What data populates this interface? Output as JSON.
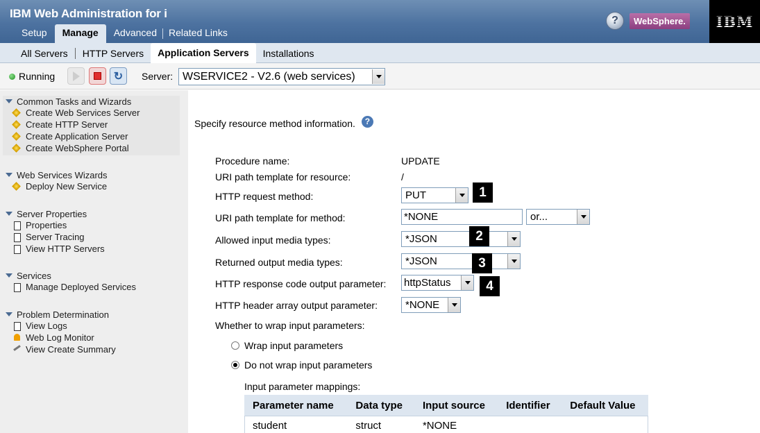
{
  "header": {
    "app_title": "IBM Web Administration for i",
    "tabs": [
      {
        "label": "Setup"
      },
      {
        "label": "Manage"
      },
      {
        "label": "Advanced"
      },
      {
        "label": "Related Links"
      }
    ],
    "help_glyph": "?",
    "websphere_label": "WebSphere.",
    "ibm_logo": "IBM"
  },
  "subnav": {
    "items": [
      {
        "label": "All Servers"
      },
      {
        "label": "HTTP Servers"
      },
      {
        "label": "Application Servers"
      },
      {
        "label": "Installations"
      }
    ]
  },
  "toolbar": {
    "status": "Running",
    "server_label": "Server:",
    "server_value": "WSERVICE2 - V2.6 (web services)",
    "refresh_glyph": "↻"
  },
  "sidebar": {
    "groups": [
      {
        "title": "Common Tasks and Wizards",
        "items": [
          {
            "label": "Create Web Services Server",
            "icon": "wizard-icon"
          },
          {
            "label": "Create HTTP Server",
            "icon": "wizard-icon"
          },
          {
            "label": "Create Application Server",
            "icon": "wizard-icon"
          },
          {
            "label": "Create WebSphere Portal",
            "icon": "wizard-icon"
          }
        ]
      },
      {
        "title": "Web Services Wizards",
        "items": [
          {
            "label": "Deploy New Service",
            "icon": "wizard-icon"
          }
        ]
      },
      {
        "title": "Server Properties",
        "items": [
          {
            "label": "Properties",
            "icon": "document-icon"
          },
          {
            "label": "Server Tracing",
            "icon": "document-icon"
          },
          {
            "label": "View HTTP Servers",
            "icon": "document-icon"
          }
        ]
      },
      {
        "title": "Services",
        "items": [
          {
            "label": "Manage Deployed Services",
            "icon": "document-icon"
          }
        ]
      },
      {
        "title": "Problem Determination",
        "items": [
          {
            "label": "View Logs",
            "icon": "document-icon"
          },
          {
            "label": "Web Log Monitor",
            "icon": "bell-icon"
          },
          {
            "label": "View Create Summary",
            "icon": "key-icon"
          }
        ]
      }
    ]
  },
  "main": {
    "instruction": "Specify resource method information.",
    "help_glyph": "?",
    "fields": {
      "procedure_name_label": "Procedure name:",
      "procedure_name_value": "UPDATE",
      "uri_resource_label": "URI path template for resource:",
      "uri_resource_value": "/",
      "http_method_label": "HTTP request method:",
      "http_method_value": "PUT",
      "uri_method_label": "URI path template for method:",
      "uri_method_value": "*NONE",
      "uri_method_or_value": "or...",
      "input_media_label": "Allowed input media types:",
      "input_media_value": "*JSON",
      "output_media_label": "Returned output media types:",
      "output_media_value": "*JSON",
      "response_code_label": "HTTP response code output parameter:",
      "response_code_value": "httpStatus",
      "header_array_label": "HTTP header array output parameter:",
      "header_array_value": "*NONE",
      "wrap_question": "Whether to wrap input parameters:",
      "wrap_option": "Wrap input parameters",
      "no_wrap_option": "Do not wrap input parameters",
      "selected_wrap": "Do not wrap input parameters"
    },
    "callouts": [
      "1",
      "2",
      "3",
      "4"
    ],
    "mappings": {
      "label": "Input parameter mappings:",
      "columns": [
        "Parameter name",
        "Data type",
        "Input source",
        "Identifier",
        "Default Value"
      ],
      "rows": [
        [
          "student",
          "struct",
          "*NONE",
          "",
          ""
        ]
      ]
    }
  }
}
